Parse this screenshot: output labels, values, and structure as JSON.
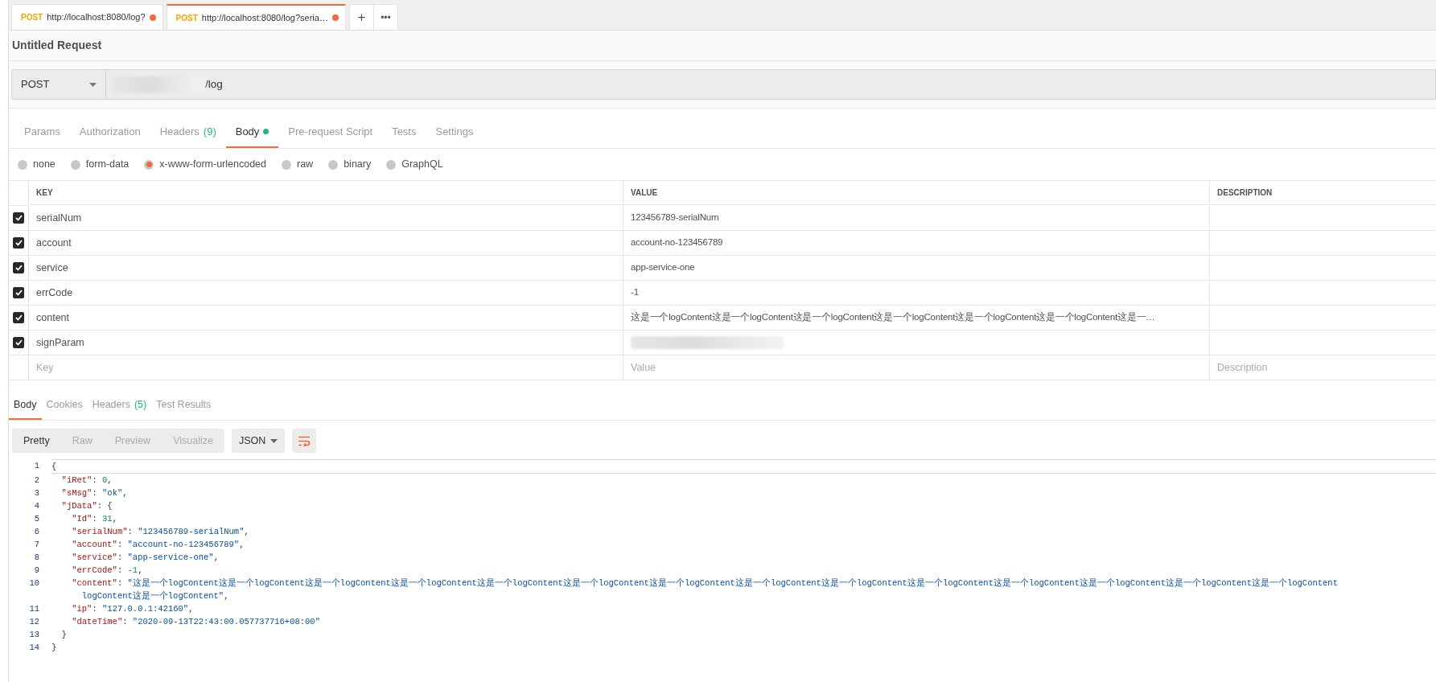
{
  "request_tabs": [
    {
      "method": "POST",
      "url": "http://localhost:8080/log?",
      "unsaved": true,
      "selected": false
    },
    {
      "method": "POST",
      "url": "http://localhost:8080/log?seria…",
      "unsaved": true,
      "selected": true
    }
  ],
  "new_tab_button": "+",
  "more_button": "•••",
  "request_title": "Untitled Request",
  "url_bar": {
    "method": "POST",
    "url": "/log",
    "host_redacted": true
  },
  "request_sections": [
    {
      "label": "Params",
      "selected": false
    },
    {
      "label": "Authorization",
      "selected": false
    },
    {
      "label": "Headers",
      "count": "(9)",
      "selected": false
    },
    {
      "label": "Body",
      "selected": true,
      "dot": true
    },
    {
      "label": "Pre-request Script",
      "selected": false
    },
    {
      "label": "Tests",
      "selected": false
    },
    {
      "label": "Settings",
      "selected": false
    }
  ],
  "body_modes": [
    {
      "label": "none",
      "selected": false
    },
    {
      "label": "form-data",
      "selected": false
    },
    {
      "label": "x-www-form-urlencoded",
      "selected": true
    },
    {
      "label": "raw",
      "selected": false
    },
    {
      "label": "binary",
      "selected": false
    },
    {
      "label": "GraphQL",
      "selected": false
    }
  ],
  "params_table": {
    "columns": [
      "KEY",
      "VALUE",
      "DESCRIPTION"
    ],
    "rows": [
      {
        "checked": true,
        "key": "serialNum",
        "value": "123456789-serialNum",
        "redacted": false
      },
      {
        "checked": true,
        "key": "account",
        "value": "account-no-123456789",
        "redacted": false
      },
      {
        "checked": true,
        "key": "service",
        "value": "app-service-one",
        "redacted": false
      },
      {
        "checked": true,
        "key": "errCode",
        "value": "-1",
        "redacted": false
      },
      {
        "checked": true,
        "key": "content",
        "value": "这是一个logContent这是一个logContent这是一个logContent这是一个logContent这是一个logContent这是一个logContent这是一…",
        "redacted": false
      },
      {
        "checked": true,
        "key": "signParam",
        "redacted": true
      }
    ],
    "new_row": {
      "key": {
        "placeholder": "Key"
      },
      "value": {
        "placeholder": "Value"
      },
      "description": {
        "placeholder": "Description"
      }
    }
  },
  "response_tabs": [
    {
      "label": "Body",
      "selected": true
    },
    {
      "label": "Cookies",
      "selected": false
    },
    {
      "label": "Headers",
      "count": "(5)",
      "selected": false
    },
    {
      "label": "Test Results",
      "selected": false
    }
  ],
  "view_modes": [
    {
      "label": "Pretty",
      "selected": true
    },
    {
      "label": "Raw",
      "selected": false
    },
    {
      "label": "Preview",
      "selected": false
    },
    {
      "label": "Visualize",
      "selected": false
    }
  ],
  "format_dropdown": "JSON",
  "code_lines": [
    {
      "number": "1",
      "active": true,
      "tokens": [
        {
          "kind": "punct",
          "text": "{"
        }
      ]
    },
    {
      "number": "2",
      "active": false,
      "tokens": [
        {
          "kind": "key",
          "text": "  \"iRet\""
        },
        {
          "kind": "punct",
          "text": ": "
        },
        {
          "kind": "number",
          "text": "0"
        },
        {
          "kind": "punct",
          "text": ","
        }
      ]
    },
    {
      "number": "3",
      "active": false,
      "tokens": [
        {
          "kind": "key",
          "text": "  \"sMsg\""
        },
        {
          "kind": "punct",
          "text": ": "
        },
        {
          "kind": "string",
          "text": "\"ok\""
        },
        {
          "kind": "punct",
          "text": ","
        }
      ]
    },
    {
      "number": "4",
      "active": false,
      "tokens": [
        {
          "kind": "key",
          "text": "  \"jData\""
        },
        {
          "kind": "punct",
          "text": ": {"
        }
      ]
    },
    {
      "number": "5",
      "active": false,
      "tokens": [
        {
          "kind": "key",
          "text": "    \"Id\""
        },
        {
          "kind": "punct",
          "text": ": "
        },
        {
          "kind": "number",
          "text": "31"
        },
        {
          "kind": "punct",
          "text": ","
        }
      ]
    },
    {
      "number": "6",
      "active": false,
      "tokens": [
        {
          "kind": "key",
          "text": "    \"serialNum\""
        },
        {
          "kind": "punct",
          "text": ": "
        },
        {
          "kind": "string",
          "text": "\"123456789-serialNum\""
        },
        {
          "kind": "punct",
          "text": ","
        }
      ]
    },
    {
      "number": "7",
      "active": false,
      "tokens": [
        {
          "kind": "key",
          "text": "    \"account\""
        },
        {
          "kind": "punct",
          "text": ": "
        },
        {
          "kind": "string",
          "text": "\"account-no-123456789\""
        },
        {
          "kind": "punct",
          "text": ","
        }
      ]
    },
    {
      "number": "8",
      "active": false,
      "tokens": [
        {
          "kind": "key",
          "text": "    \"service\""
        },
        {
          "kind": "punct",
          "text": ": "
        },
        {
          "kind": "string",
          "text": "\"app-service-one\""
        },
        {
          "kind": "punct",
          "text": ","
        }
      ]
    },
    {
      "number": "9",
      "active": false,
      "tokens": [
        {
          "kind": "key",
          "text": "    \"errCode\""
        },
        {
          "kind": "punct",
          "text": ": "
        },
        {
          "kind": "number",
          "text": "-1"
        },
        {
          "kind": "punct",
          "text": ","
        }
      ]
    },
    {
      "number": "10",
      "active": false,
      "tokens": [
        {
          "kind": "key",
          "text": "    \"content\""
        },
        {
          "kind": "punct",
          "text": ": "
        },
        {
          "kind": "string",
          "text": "\"这是一个logContent这是一个logContent这是一个logContent这是一个logContent这是一个logContent这是一个logContent这是一个logContent这是一个logContent这是一个logContent这是一个logContent这是一个logContent这是一个logContent这是一个logContent这是一个logContent"
        }
      ],
      "continuation": [
        {
          "kind": "string",
          "text": "      logContent这是一个logContent\""
        },
        {
          "kind": "punct",
          "text": ","
        }
      ]
    },
    {
      "number": "11",
      "active": false,
      "tokens": [
        {
          "kind": "key",
          "text": "    \"ip\""
        },
        {
          "kind": "punct",
          "text": ": "
        },
        {
          "kind": "string",
          "text": "\"127.0.0.1:42160\""
        },
        {
          "kind": "punct",
          "text": ","
        }
      ]
    },
    {
      "number": "12",
      "active": false,
      "tokens": [
        {
          "kind": "key",
          "text": "    \"dateTime\""
        },
        {
          "kind": "punct",
          "text": ": "
        },
        {
          "kind": "string",
          "text": "\"2020-09-13T22:43:00.057737716+08:00\""
        }
      ]
    },
    {
      "number": "13",
      "active": false,
      "tokens": [
        {
          "kind": "punct",
          "text": "  }"
        }
      ]
    },
    {
      "number": "14",
      "active": false,
      "tokens": [
        {
          "kind": "punct",
          "text": "}"
        }
      ]
    }
  ]
}
